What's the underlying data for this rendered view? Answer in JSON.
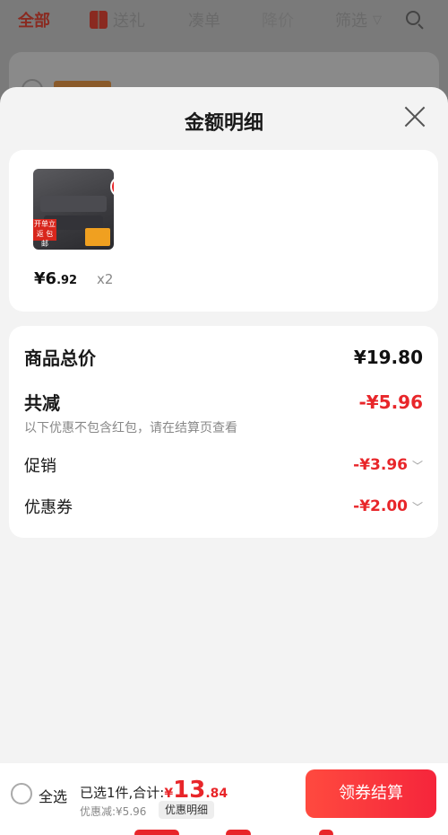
{
  "topbar": {
    "all": "全部",
    "gift": "送礼",
    "order": "凑单",
    "price_drop": "降价",
    "filter": "筛选"
  },
  "sheet": {
    "title": "金额明细"
  },
  "goods": {
    "price_int": "¥6",
    "price_dec": ".92",
    "qty": "x2",
    "thumb_ribbon": "开单立返 包邮"
  },
  "detail": {
    "total_label": "商品总价",
    "total_value": "¥19.80",
    "reduce_label": "共减",
    "reduce_value": "-¥5.96",
    "note": "以下优惠不包含红包，请在结算页查看",
    "promo_label": "促销",
    "promo_value": "-¥3.96",
    "coupon_label": "优惠券",
    "coupon_value": "-¥2.00"
  },
  "bottom": {
    "select_all": "全选",
    "selected_text": "已选1件,合计:",
    "total_symbol": "¥",
    "total_int": "13",
    "total_dec": ".84",
    "discount": "优惠减:¥5.96",
    "detail_chip": "优惠明细",
    "checkout": "领券结算"
  },
  "colors": {
    "accent": "#e8262a"
  }
}
